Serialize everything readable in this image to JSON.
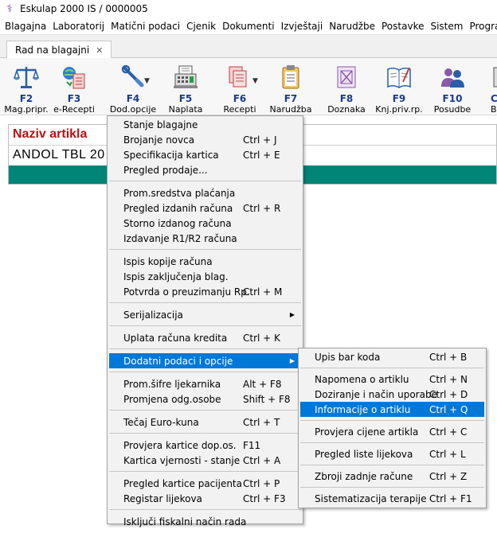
{
  "window": {
    "title": "Eskulap 2000  IS / 0000005"
  },
  "menubar": [
    "Blagajna",
    "Laboratorij",
    "Matični podaci",
    "Cjenik",
    "Dokumenti",
    "Izvještaji",
    "Narudžbe",
    "Postavke",
    "Sistem",
    "Program"
  ],
  "tab": {
    "label": "Rad na blagajni"
  },
  "toolbar": [
    {
      "key": "F2",
      "label": "Mag.pripr.",
      "icon": "scales-icon"
    },
    {
      "key": "F3",
      "label": "e-Recepti",
      "icon": "e-recipe-icon"
    },
    {
      "key": "F4",
      "label": "Dod.opcije",
      "icon": "tools-icon"
    },
    {
      "key": "F5",
      "label": "Naplata",
      "icon": "cash-register-icon"
    },
    {
      "key": "F6",
      "label": "Recepti",
      "icon": "recipes-icon"
    },
    {
      "key": "F7",
      "label": "Narudžba",
      "icon": "clipboard-icon"
    },
    {
      "key": "F8",
      "label": "Doznaka",
      "icon": "voucher-icon"
    },
    {
      "key": "F9",
      "label": "Knj.priv.rp.",
      "icon": "book-icon"
    },
    {
      "key": "F10",
      "label": "Posudbe",
      "icon": "people-icon"
    },
    {
      "key": "C",
      "label": "Br",
      "icon": "partial-icon"
    }
  ],
  "panel": {
    "header": "Naziv artikla",
    "value": "ANDOL TBL 20",
    "bar_color": "#008577"
  },
  "main_menu": {
    "groups": [
      [
        {
          "label": "Stanje blagajne",
          "shortcut": ""
        },
        {
          "label": "Brojanje novca",
          "shortcut": "Ctrl + J"
        },
        {
          "label": "Specifikacija kartica",
          "shortcut": "Ctrl + E"
        },
        {
          "label": "Pregled prodaje...",
          "shortcut": ""
        }
      ],
      [
        {
          "label": "Prom.sredstva plaćanja",
          "shortcut": ""
        },
        {
          "label": "Pregled izdanih računa",
          "shortcut": "Ctrl + R"
        },
        {
          "label": "Storno izdanog računa",
          "shortcut": ""
        },
        {
          "label": "Izdavanje R1/R2 računa",
          "shortcut": ""
        }
      ],
      [
        {
          "label": "Ispis kopije računa",
          "shortcut": ""
        },
        {
          "label": "Ispis zaključenja blag.",
          "shortcut": ""
        },
        {
          "label": "Potvrda o preuzimanju Rp.",
          "shortcut": "Ctrl + M"
        }
      ],
      [
        {
          "label": "Serijalizacija",
          "shortcut": "",
          "submenu": true
        }
      ],
      [
        {
          "label": "Uplata računa kredita",
          "shortcut": "Ctrl + K"
        }
      ],
      [
        {
          "label": "Dodatni podaci i opcije",
          "shortcut": "",
          "submenu": true,
          "highlighted": true
        }
      ],
      [
        {
          "label": "Prom.šifre ljekarnika",
          "shortcut": "Alt + F8"
        },
        {
          "label": "Promjena odg.osobe",
          "shortcut": "Shift + F8"
        }
      ],
      [
        {
          "label": "Tečaj Euro-kuna",
          "shortcut": "Ctrl + T"
        }
      ],
      [
        {
          "label": "Provjera kartice dop.os.",
          "shortcut": "F11"
        },
        {
          "label": "Kartica vjernosti - stanje",
          "shortcut": "Ctrl + A"
        }
      ],
      [
        {
          "label": "Pregled kartice pacijenta",
          "shortcut": "Ctrl + P"
        },
        {
          "label": "Registar lijekova",
          "shortcut": "Ctrl + F3"
        }
      ],
      [
        {
          "label": "Isključi fiskalni način rada",
          "shortcut": ""
        }
      ]
    ]
  },
  "sub_menu": {
    "groups": [
      [
        {
          "label": "Upis bar koda",
          "shortcut": "Ctrl + B"
        }
      ],
      [
        {
          "label": "Napomena o artiklu",
          "shortcut": "Ctrl + N"
        },
        {
          "label": "Doziranje i način uporabe",
          "shortcut": "Ctrl + D"
        },
        {
          "label": "Informacije o artiklu",
          "shortcut": "Ctrl + Q",
          "highlighted": true
        }
      ],
      [
        {
          "label": "Provjera cijene artikla",
          "shortcut": "Ctrl + C"
        }
      ],
      [
        {
          "label": "Pregled liste lijekova",
          "shortcut": "Ctrl + L"
        }
      ],
      [
        {
          "label": "Zbroji zadnje račune",
          "shortcut": "Ctrl + Z"
        }
      ],
      [
        {
          "label": "Sistematizacija terapije",
          "shortcut": "Ctrl + F1"
        }
      ]
    ]
  }
}
